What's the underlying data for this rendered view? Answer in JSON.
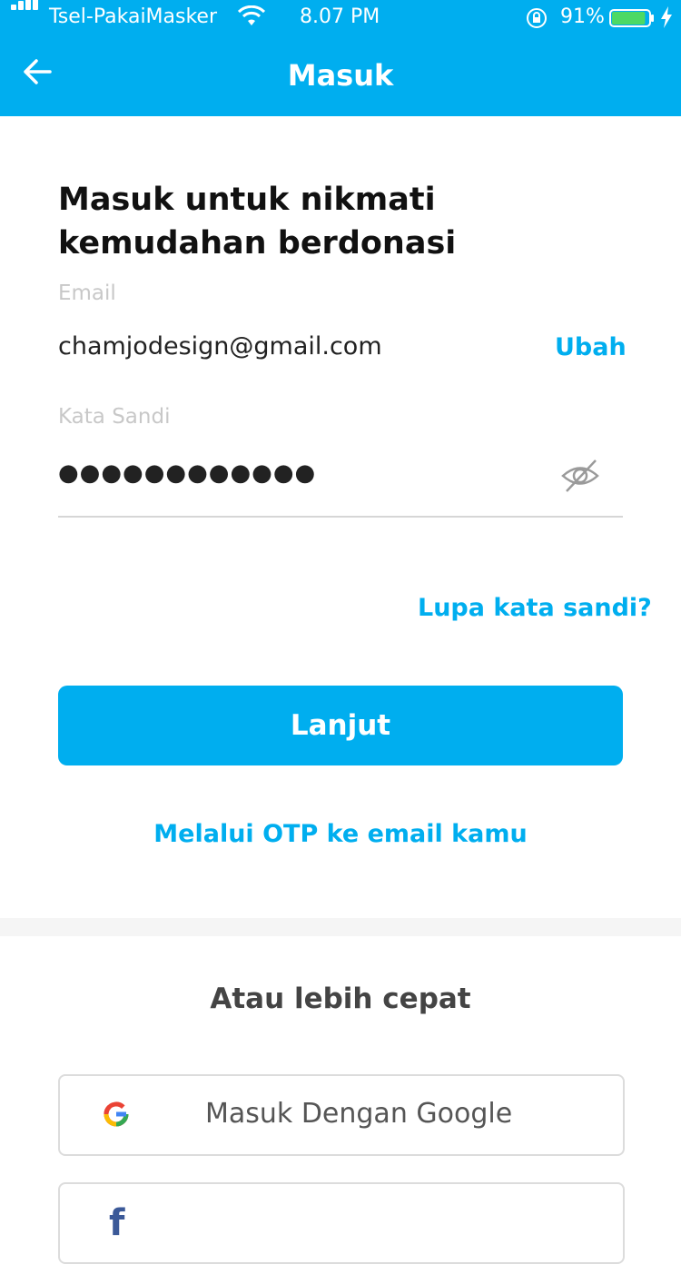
{
  "status_bar": {
    "carrier": "Tsel-PakaiMasker",
    "time": "8.07 PM",
    "battery_percent": "91%",
    "battery_level": 0.91,
    "icons": [
      "signal-icon",
      "wifi-icon",
      "orientation-lock-icon",
      "battery-icon",
      "charging-icon"
    ]
  },
  "header": {
    "title": "Masuk",
    "back_icon": "arrow-left-icon"
  },
  "form": {
    "heading": "Masuk untuk nikmati kemudahan berdonasi",
    "email_label": "Email",
    "email_value": "chamjodesign@gmail.com",
    "change_link": "Ubah",
    "password_label": "Kata Sandi",
    "password_value": "●●●●●●●●●●●●",
    "visibility_icon": "eye-slash-icon",
    "forgot_link": "Lupa kata sandi?",
    "submit_label": "Lanjut",
    "otp_link": "Melalui OTP ke email kamu"
  },
  "alternative": {
    "heading": "Atau lebih cepat",
    "google_label": "Masuk Dengan Google",
    "google_icon": "google-icon",
    "facebook_icon": "facebook-icon"
  },
  "colors": {
    "brand": "#00aeef",
    "battery_fill": "#4cd964",
    "facebook": "#3b5998"
  }
}
